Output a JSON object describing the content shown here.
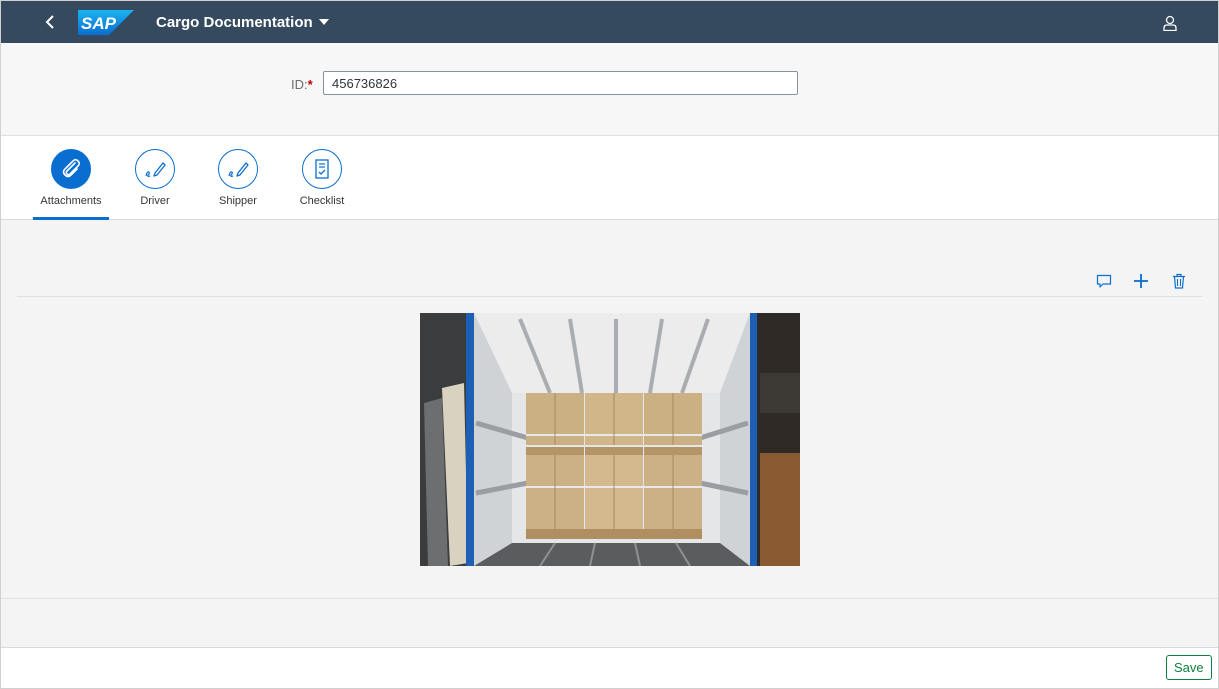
{
  "shell": {
    "logo_text": "SAP",
    "title": "Cargo Documentation",
    "back_icon": "chevron-left-icon",
    "title_dropdown_icon": "caret-down-icon",
    "user_icon": "person-icon",
    "background_color": "#354a5f"
  },
  "header": {
    "id_label": "ID:",
    "required_marker": "*",
    "id_value": "456736826"
  },
  "tabs": [
    {
      "label": "Attachments",
      "icon": "paperclip-icon",
      "active": true
    },
    {
      "label": "Driver",
      "icon": "signature-icon",
      "active": false
    },
    {
      "label": "Shipper",
      "icon": "signature-icon",
      "active": false
    },
    {
      "label": "Checklist",
      "icon": "checklist-icon",
      "active": false
    }
  ],
  "attachments_toolbar": {
    "icons": [
      "comment-icon",
      "add-icon",
      "delete-icon"
    ]
  },
  "attachment": {
    "image_subject": "cargo-truck-interior-with-palletized-boxes"
  },
  "footer": {
    "save_label": "Save"
  },
  "colors": {
    "accent": "#0a6ed1",
    "save": "#107e3e",
    "required": "#bb0000"
  }
}
